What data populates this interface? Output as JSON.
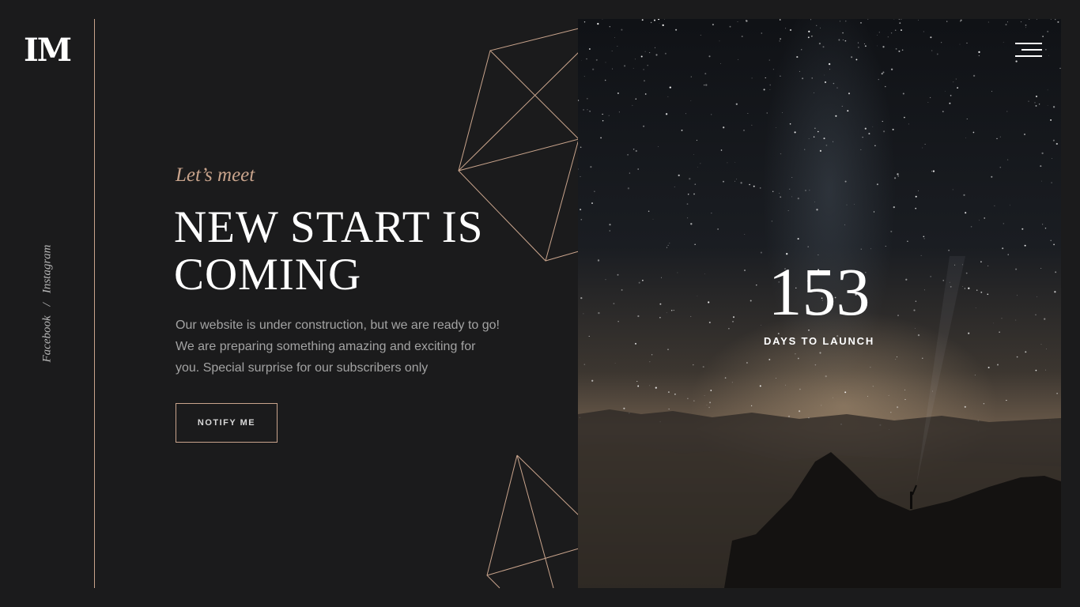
{
  "brand": {
    "logo_text": "IM"
  },
  "social": {
    "links": [
      "Facebook",
      "Instagram"
    ],
    "separator": "/"
  },
  "hero_text": {
    "eyebrow": "Let’s meet",
    "headline": "NEW START IS COMING",
    "description": "Our website is under construction, but we are ready to go! We are preparing something amazing and exciting for you. Special surprise for our subscribers only",
    "cta_label": "NOTIFY ME"
  },
  "countdown": {
    "value": "153",
    "label": "DAYS TO LAUNCH"
  },
  "nav": {
    "menu_icon": "hamburger-menu-icon"
  },
  "colors": {
    "background": "#1b1b1c",
    "accent": "#c9a48c",
    "text": "#ffffff",
    "muted": "#a3a3a3"
  }
}
